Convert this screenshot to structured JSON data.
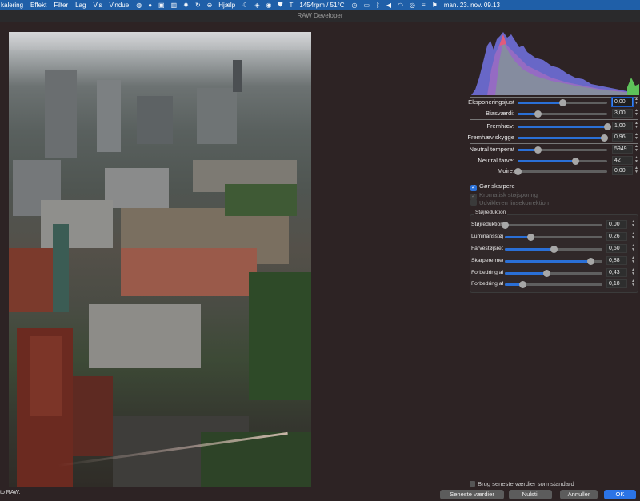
{
  "menubar": {
    "items": [
      "kalering",
      "Effekt",
      "Filter",
      "Lag",
      "Vis",
      "Vindue"
    ],
    "help": "Hjælp",
    "fan_status": "1454rpm / 51°C",
    "clock": "man. 23. nov.  09.13",
    "color": "#1f5fa8"
  },
  "window": {
    "title": "RAW Developer"
  },
  "statusbar": {
    "text": "to RAW."
  },
  "histogram": {
    "icon": "histogram-chart"
  },
  "adjust": {
    "exposure": {
      "label": "Eksponeringsjust",
      "value": "0,00",
      "level": 0.5
    },
    "bias": {
      "label": "Biasværdi:",
      "value": "3,00",
      "level": 0.22
    },
    "highlight": {
      "label": "Fremhæv:",
      "value": "1,00",
      "level": 1.0
    },
    "shadow": {
      "label": "Fremhæv skygge",
      "value": "0,96",
      "level": 0.96
    },
    "temperature": {
      "label": "Neutral temperat",
      "value": "5949",
      "level": 0.22
    },
    "tint": {
      "label": "Neutral farve:",
      "value": "42",
      "level": 0.64
    },
    "moire": {
      "label": "Moire:",
      "value": "0,00",
      "level": 0.0
    }
  },
  "options": {
    "sharpen": {
      "label": "Gør skarpere",
      "checked": true
    },
    "chromatic": {
      "label": "Kromatisk støjsporing",
      "checked": true,
      "enabled": false
    },
    "lens": {
      "label": "Udvikleren linsekorrektion",
      "checked": false,
      "enabled": false
    }
  },
  "noise": {
    "group_title": "Støjreduktion",
    "rows": [
      {
        "label": "Støjreduktion",
        "value": "0,00",
        "level": 0.0
      },
      {
        "label": "Luminansstøj",
        "value": "0,26",
        "level": 0.26
      },
      {
        "label": "Farvestøjsred",
        "value": "0,50",
        "level": 0.5
      },
      {
        "label": "Skarpere med",
        "value": "0,88",
        "level": 0.88
      },
      {
        "label": "Forbedring af",
        "value": "0,43",
        "level": 0.43
      },
      {
        "label": "Forbedring af",
        "value": "0,18",
        "level": 0.18
      }
    ]
  },
  "footer": {
    "use_recent": "Brug seneste værdier som standard",
    "recent_button": "Seneste værdier",
    "reset_button": "Nulstil",
    "cancel_button": "Annuller",
    "ok_button": "OK",
    "accent": "#2b74e6"
  }
}
